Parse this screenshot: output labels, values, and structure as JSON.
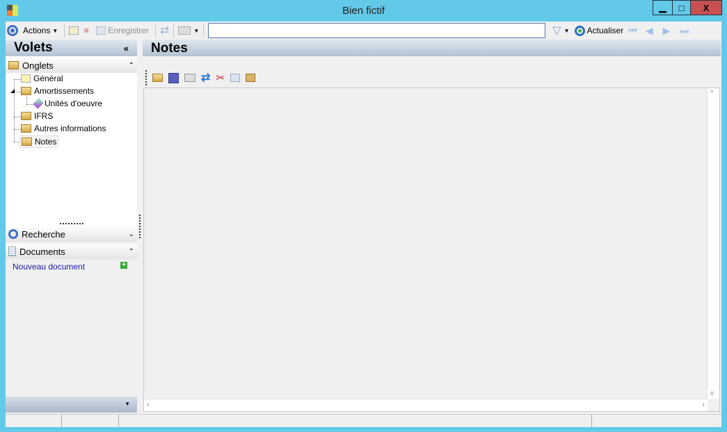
{
  "window": {
    "title": "Bien fictif",
    "minimize": "▁",
    "maximize": "□",
    "close": "X"
  },
  "toolbar": {
    "actions": "Actions",
    "save": "Enregistrer",
    "search_value": "",
    "refresh": "Actualiser"
  },
  "left": {
    "title": "Volets",
    "collapse": "«",
    "onglets": {
      "label": "Onglets",
      "items": [
        {
          "label": "Général"
        },
        {
          "label": "Amortissements"
        },
        {
          "label": "Unités d'oeuvre"
        },
        {
          "label": "IFRS"
        },
        {
          "label": "Autres informations"
        },
        {
          "label": "Notes"
        }
      ]
    },
    "recherche": "Recherche",
    "documents": "Documents",
    "new_document": "Nouveau document"
  },
  "main": {
    "title": "Notes"
  }
}
